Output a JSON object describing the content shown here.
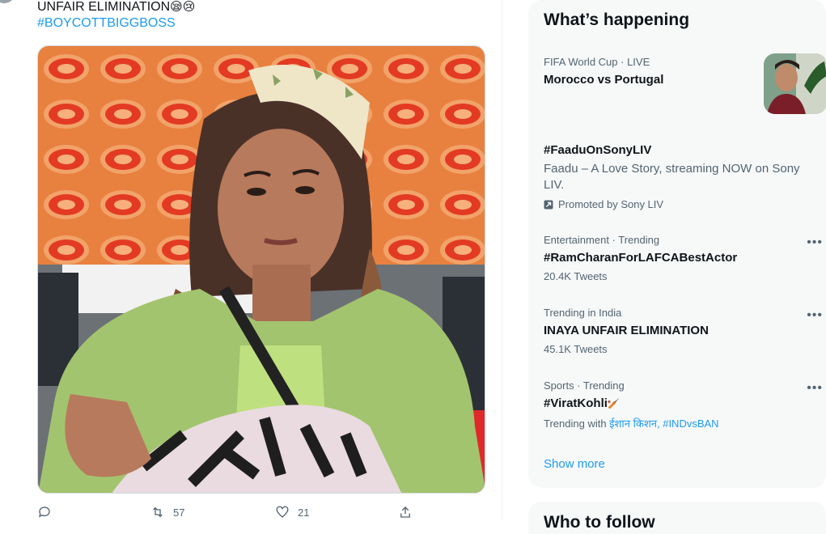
{
  "tweet": {
    "text_line1": "UNFAIR ELIMINATION",
    "emoji_line1": "😪😢",
    "hashtag": "#BOYCOTTBIGGBOSS",
    "actions": {
      "reply_count": "",
      "retweet_count": "57",
      "like_count": "21"
    }
  },
  "sidebar": {
    "title": "What’s happening",
    "trends": [
      {
        "meta": "FIFA World Cup · LIVE",
        "name": "Morocco vs Portugal"
      },
      {
        "name": "#FaaduOnSonyLIV",
        "description": "Faadu – A Love Story, streaming NOW on Sony LIV.",
        "promoted": "Promoted by Sony LIV"
      },
      {
        "meta": "Entertainment · Trending",
        "name": "#RamCharanForLAFCABestActor",
        "count": "20.4K Tweets"
      },
      {
        "meta": "Trending in India",
        "name": "INAYA UNFAIR ELIMINATION",
        "count": "45.1K Tweets"
      },
      {
        "meta": "Sports · Trending",
        "name": "#ViratKohli",
        "name_emoji": "🏏",
        "with_prefix": "Trending with ",
        "with_tags": "ईशान किशन, #INDvsBAN"
      }
    ],
    "show_more": "Show more",
    "next_card_title": "Who to follow"
  },
  "colors": {
    "accent": "#1d9bf0",
    "secondary_text": "#536471",
    "card_bg": "#f7f9f9"
  },
  "icons": [
    "reply-icon",
    "retweet-icon",
    "like-icon",
    "share-icon",
    "more-icon",
    "promoted-icon"
  ]
}
